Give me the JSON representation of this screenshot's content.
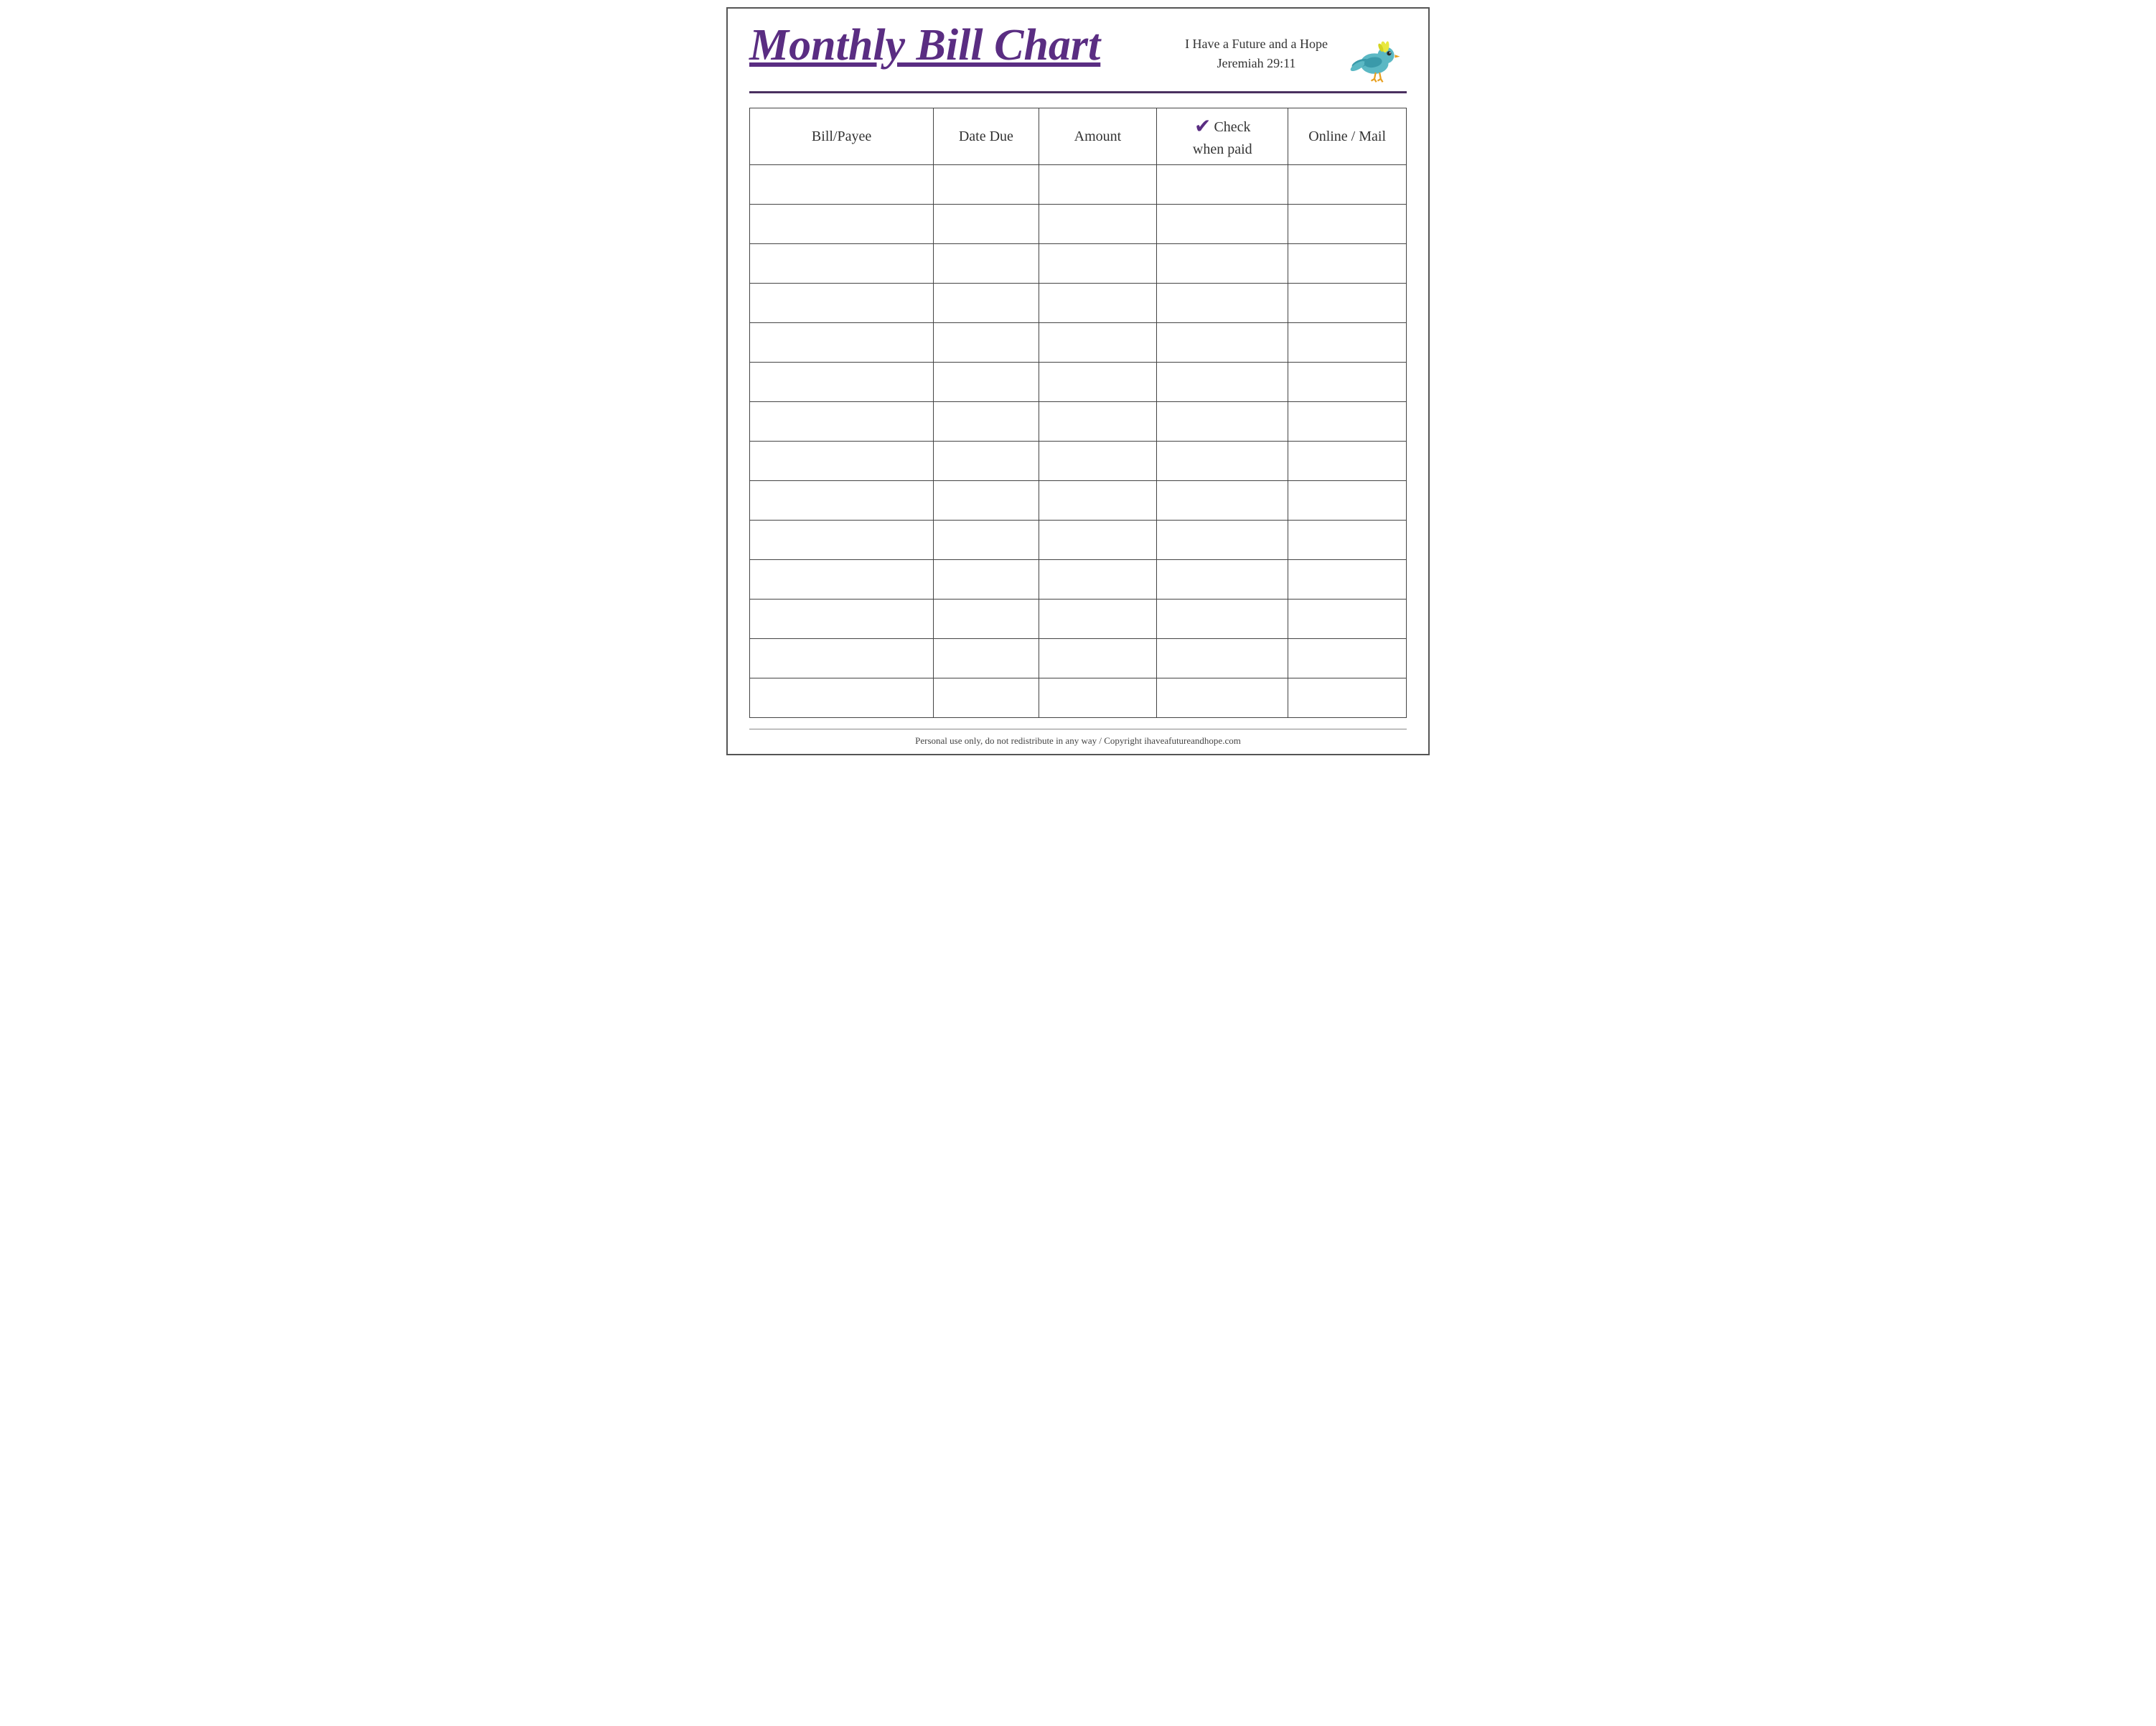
{
  "header": {
    "title": "Monthly Bill Chart",
    "subtitle_line1": "I Have a Future and a Hope",
    "subtitle_line2": "Jeremiah 29:11"
  },
  "table": {
    "columns": [
      {
        "id": "payee",
        "label": "Bill/Payee"
      },
      {
        "id": "due",
        "label": "Date Due"
      },
      {
        "id": "amount",
        "label": "Amount"
      },
      {
        "id": "check",
        "label": "Check when paid",
        "has_checkmark": true
      },
      {
        "id": "online",
        "label": "Online / Mail"
      }
    ],
    "row_count": 14
  },
  "footer": {
    "text": "Personal use only, do not redistribute in any way / Copyright ihaveafutureandhope.com"
  }
}
